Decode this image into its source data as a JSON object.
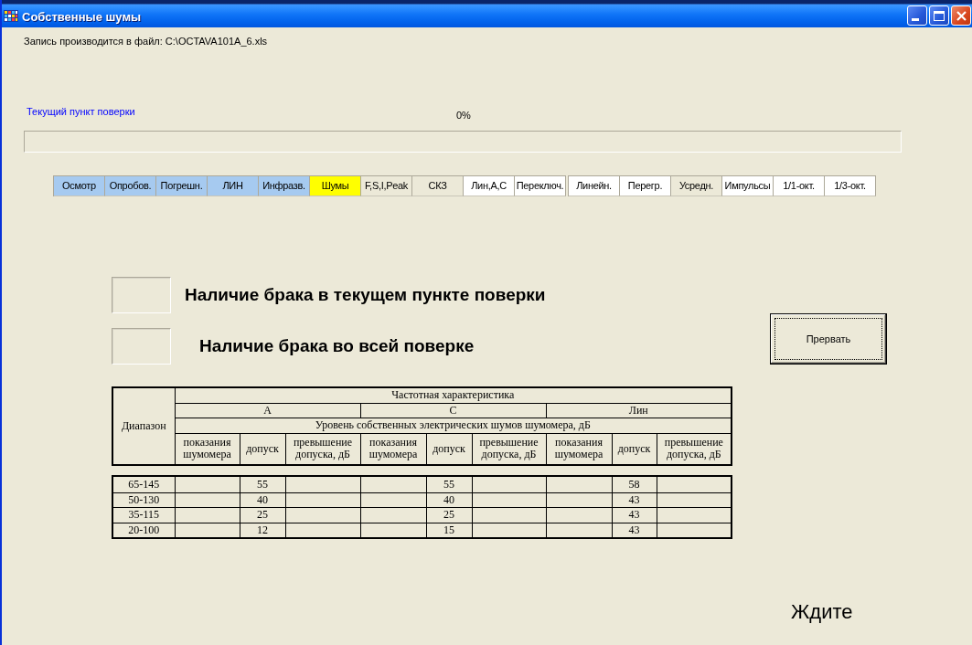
{
  "window": {
    "title": "Собственные шумы"
  },
  "file_note": "Запись производится в файл: C:\\OCTAVA101A_6.xls",
  "progress": {
    "label": "Текущий пункт поверки",
    "reading": "0%",
    "level": 0
  },
  "tab_groups": [
    {
      "tabs": [
        {
          "label": "Осмотр",
          "color": "#a6caf0"
        },
        {
          "label": "Опробов.",
          "color": "#a6caf0"
        },
        {
          "label": "Погрешн.",
          "color": "#a6caf0"
        },
        {
          "label": "ЛИН",
          "color": "#a6caf0"
        },
        {
          "label": "Инфразв.",
          "color": "#a6caf0"
        },
        {
          "label": "Шумы",
          "color": "#ffff00"
        },
        {
          "label": "F,S,I,Peak",
          "color": "#ece9d8"
        },
        {
          "label": "СКЗ",
          "color": "#ece9d8"
        },
        {
          "label": "Лин,A,C",
          "color": "#ffffff"
        },
        {
          "label": "Переключ.",
          "color": "#ffffff"
        }
      ]
    },
    {
      "tabs": [
        {
          "label": "Линейн.",
          "color": "#ffffff"
        },
        {
          "label": "Перегр.",
          "color": "#ffffff"
        },
        {
          "label": "Усредн.",
          "color": "#ece9d8"
        },
        {
          "label": "Импульсы",
          "color": "#ffffff"
        },
        {
          "label": "1/1-окт.",
          "color": "#ffffff"
        },
        {
          "label": "1/3-окт.",
          "color": "#ffffff"
        }
      ]
    }
  ],
  "indicators": [
    {
      "label": "Наличие брака в текущем пункте поверки"
    },
    {
      "label": "Наличие брака во всей поверке"
    }
  ],
  "abort_button": "Прервать",
  "table": {
    "title": "Частотная характеристика",
    "row_header": "Диапазон",
    "subtitle": "Уровень собственных электрических шумов шумомера, дБ",
    "groups": [
      {
        "name": "A",
        "columns": [
          "показания шумомера",
          "допуск",
          "превышение допуска, дБ"
        ]
      },
      {
        "name": "C",
        "columns": [
          "показания шумомера",
          "допуск",
          "превышение допуска, дБ"
        ]
      },
      {
        "name": "Лин",
        "columns": [
          "показания шумомера",
          "допуск",
          "превышение допуска, дБ"
        ]
      }
    ],
    "rows": [
      {
        "range": "65-145",
        "tolerances": [
          "55",
          "55",
          "58"
        ]
      },
      {
        "range": "50-130",
        "tolerances": [
          "40",
          "40",
          "43"
        ]
      },
      {
        "range": "35-115",
        "tolerances": [
          "25",
          "25",
          "43"
        ]
      },
      {
        "range": "20-100",
        "tolerances": [
          "12",
          "15",
          "43"
        ]
      }
    ]
  },
  "status_text": "Ждите"
}
